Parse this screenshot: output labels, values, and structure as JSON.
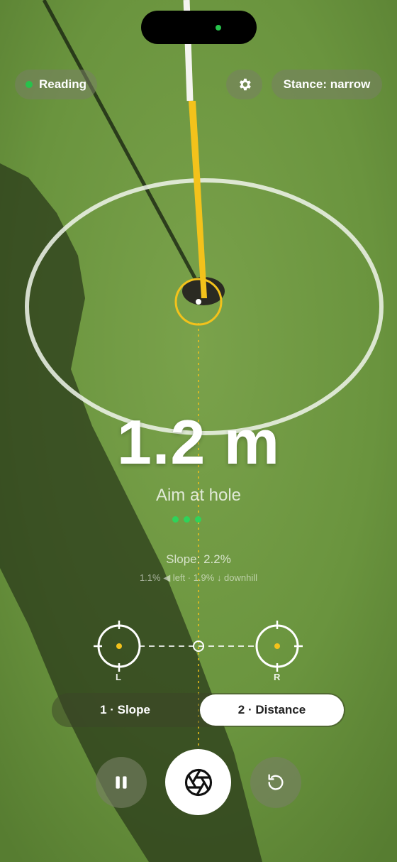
{
  "status": {
    "label": "Reading",
    "dot_color": "#27c24c"
  },
  "settings": {
    "icon": "gear-icon"
  },
  "stance": {
    "label": "Stance: narrow"
  },
  "measurement": {
    "distance": "1.2 m",
    "instruction": "Aim at hole",
    "progress_dots": 3
  },
  "slope": {
    "title": "Slope: 2.2%",
    "detail": "1.1% ◀ left · 1.9% ↓ downhill"
  },
  "markers": {
    "left_label": "L",
    "right_label": "R"
  },
  "mode_switch": {
    "options": [
      "1 · Slope",
      "2 · Distance"
    ],
    "selected": "2 · Distance"
  },
  "controls": {
    "pause_icon": "pause-icon",
    "capture_icon": "aperture-icon",
    "reset_icon": "rotate-ccw-icon"
  },
  "colors": {
    "accent_yellow": "#f3c21b",
    "status_green": "#27c24c"
  }
}
